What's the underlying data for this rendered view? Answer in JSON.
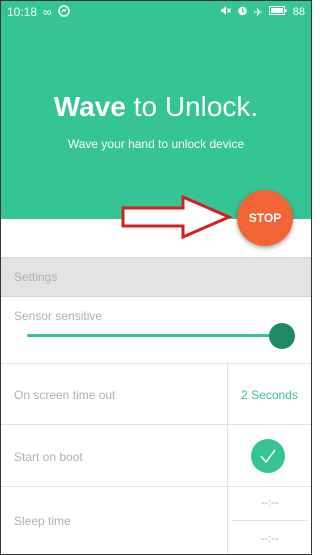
{
  "status_bar": {
    "time": "10:18",
    "battery": "88",
    "icons": [
      "infinity-icon",
      "messenger-icon",
      "mute-icon",
      "alarm-icon",
      "airplane-icon",
      "battery-icon"
    ]
  },
  "hero": {
    "title_bold": "Wave",
    "title_rest": " to Unlock.",
    "subtitle": "Wave your hand to unlock device",
    "background_color": "#35c493"
  },
  "stop_button": {
    "label": "STOP",
    "color": "#f26435"
  },
  "settings": {
    "header": "Settings",
    "sensor_label": "Sensor sensitive",
    "sensor_level": 1.0,
    "screen_timeout_label": "On screen time out",
    "screen_timeout_value": "2 Seconds",
    "start_on_boot_label": "Start on boot",
    "start_on_boot_enabled": true,
    "sleep_time_label": "Sleep time",
    "sleep_start": "--:--",
    "sleep_end": "--:--"
  }
}
